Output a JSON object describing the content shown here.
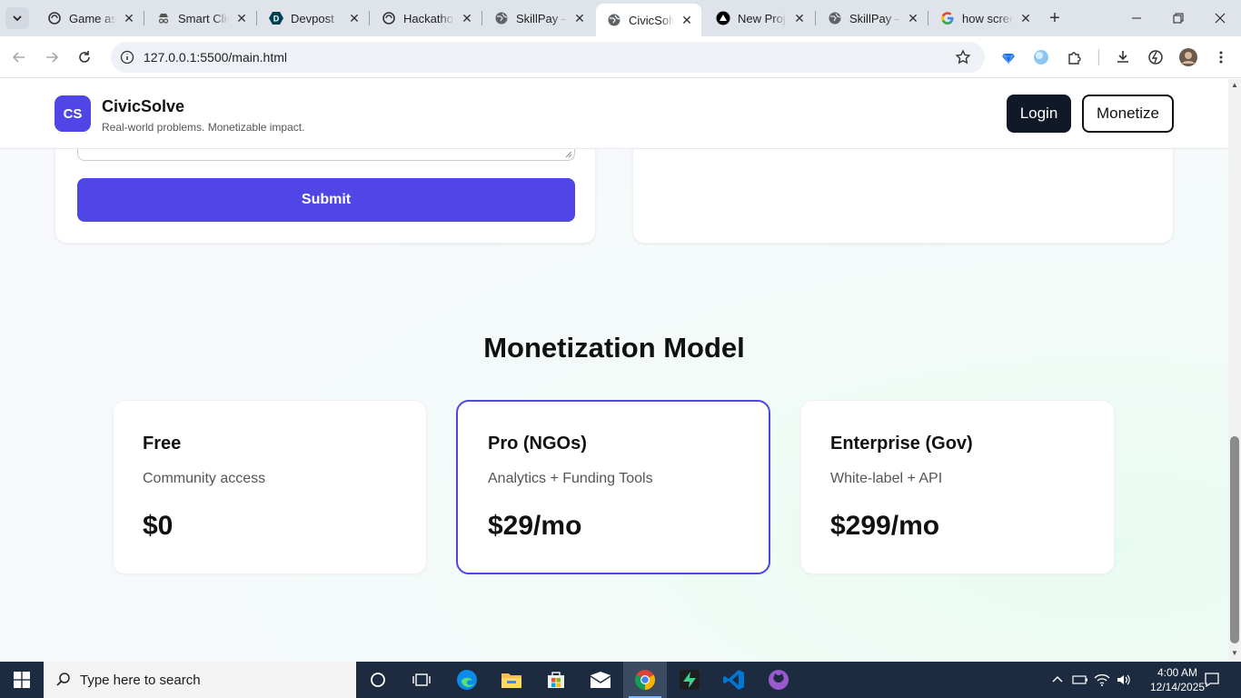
{
  "browser": {
    "tabs": [
      {
        "title": "Game ass",
        "icon": "chatgpt-icon"
      },
      {
        "title": "Smart Clic",
        "icon": "spy-icon"
      },
      {
        "title": "Devpost",
        "icon": "devpost-icon"
      },
      {
        "title": "Hackatho",
        "icon": "chatgpt-icon"
      },
      {
        "title": "SkillPay –",
        "icon": "globe-icon"
      },
      {
        "title": "CivicSolve",
        "icon": "globe-icon",
        "active": true
      },
      {
        "title": "New Proje",
        "icon": "vercel-icon"
      },
      {
        "title": "SkillPay –",
        "icon": "globe-icon"
      },
      {
        "title": "how scree",
        "icon": "google-icon"
      }
    ],
    "url": "127.0.0.1:5500/main.html"
  },
  "site": {
    "logo_text": "CS",
    "brand_name": "CivicSolve",
    "tagline": "Real-world problems. Monetizable impact.",
    "login_label": "Login",
    "monetize_label": "Monetize",
    "submit_label": "Submit",
    "accent_color": "#4f46e5"
  },
  "monetization": {
    "title": "Monetization Model",
    "plans": [
      {
        "name": "Free",
        "description": "Community access",
        "price": "$0"
      },
      {
        "name": "Pro (NGOs)",
        "description": "Analytics + Funding Tools",
        "price": "$29/mo",
        "featured": true
      },
      {
        "name": "Enterprise (Gov)",
        "description": "White-label + API",
        "price": "$299/mo"
      }
    ]
  },
  "taskbar": {
    "search_placeholder": "Type here to search",
    "time": "4:00 AM",
    "date": "12/14/2025"
  }
}
